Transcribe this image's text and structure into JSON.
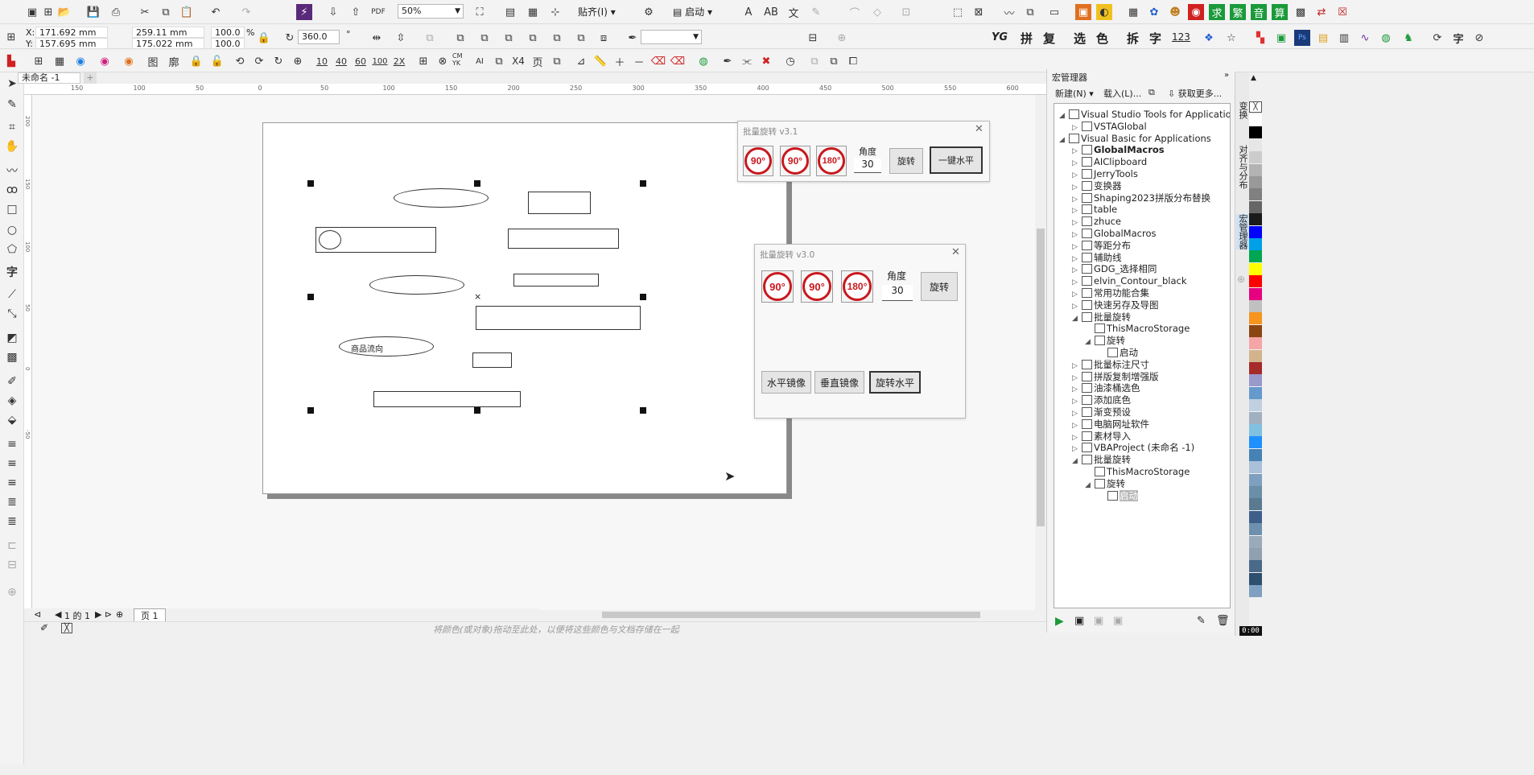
{
  "toolbar1": {
    "zoom": "50%",
    "snap_label": "贴齐(I)",
    "launch_label": "启动"
  },
  "toolbar2": {
    "x": "171.692 mm",
    "y": "157.695 mm",
    "w": "259.11 mm",
    "h": "175.022 mm",
    "sx": "100.0",
    "sy": "100.0",
    "pct": "%",
    "angle": "360.0",
    "x_lbl": "X:",
    "y_lbl": "Y:",
    "tool_text": [
      "拼",
      "复",
      "选",
      "色",
      "拆",
      "字",
      "123"
    ],
    "tool_logo": "YG"
  },
  "toolbar3": {
    "buttons": [
      "10",
      "40",
      "60",
      "100",
      "2X",
      "CM YK",
      "X4",
      "页"
    ]
  },
  "tab": {
    "doc": "未命名 -1"
  },
  "ruler": {
    "h": [
      "150",
      "100",
      "50",
      "0",
      "50",
      "100",
      "150",
      "200",
      "250",
      "300",
      "350",
      "400",
      "450",
      "500",
      "550",
      "600"
    ],
    "v": [
      "200",
      "150",
      "100",
      "50",
      "0",
      "-50"
    ]
  },
  "canvas": {
    "ellipse_text": "商品流向"
  },
  "dialog1": {
    "title": "批量旋转 v3.1",
    "angle_label": "角度",
    "angle_value": "30",
    "rotate": "旋转",
    "level": "一键水平",
    "r90a": "90°",
    "r90b": "90°",
    "r180": "180°"
  },
  "dialog2": {
    "title": "批量旋转 v3.0",
    "angle_label": "角度",
    "angle_value": "30",
    "rotate": "旋转",
    "mirror_h": "水平镜像",
    "mirror_v": "垂直镜像",
    "rotate_level": "旋转水平",
    "r90a": "90°",
    "r90b": "90°",
    "r180": "180°"
  },
  "pagenav": {
    "pages": "1 的 1",
    "page_tab": "页 1"
  },
  "status": {
    "hint": "将颜色(或对象)拖动至此处，以便将这些颜色与文档存储在一起"
  },
  "macro": {
    "title": "宏管理器",
    "new": "新建(N)",
    "load": "载入(L)...",
    "get_more": "获取更多...",
    "items": [
      {
        "label": "Visual Studio Tools for Applications",
        "lvl": 0,
        "exp": "◢"
      },
      {
        "label": "VSTAGlobal",
        "lvl": 1,
        "exp": "▷"
      },
      {
        "label": "Visual Basic for Applications",
        "lvl": 0,
        "exp": "◢"
      },
      {
        "label": "GlobalMacros",
        "lvl": 1,
        "exp": "▷",
        "bold": true
      },
      {
        "label": "AIClipboard",
        "lvl": 1,
        "exp": "▷"
      },
      {
        "label": "JerryTools",
        "lvl": 1,
        "exp": "▷"
      },
      {
        "label": "变换器",
        "lvl": 1,
        "exp": "▷"
      },
      {
        "label": "Shaping2023拼版分布替换",
        "lvl": 1,
        "exp": "▷"
      },
      {
        "label": "table",
        "lvl": 1,
        "exp": "▷"
      },
      {
        "label": "zhuce",
        "lvl": 1,
        "exp": "▷"
      },
      {
        "label": "GlobalMacros",
        "lvl": 1,
        "exp": "▷"
      },
      {
        "label": "等距分布",
        "lvl": 1,
        "exp": "▷"
      },
      {
        "label": "辅助线",
        "lvl": 1,
        "exp": "▷"
      },
      {
        "label": "GDG_选择相同",
        "lvl": 1,
        "exp": "▷"
      },
      {
        "label": "elvin_Contour_black",
        "lvl": 1,
        "exp": "▷"
      },
      {
        "label": "常用功能合集",
        "lvl": 1,
        "exp": "▷"
      },
      {
        "label": "快速另存及导图",
        "lvl": 1,
        "exp": "▷"
      },
      {
        "label": "批量旋转",
        "lvl": 1,
        "exp": "◢"
      },
      {
        "label": "ThisMacroStorage",
        "lvl": 2,
        "exp": ""
      },
      {
        "label": "旋转",
        "lvl": 2,
        "exp": "◢"
      },
      {
        "label": "启动",
        "lvl": 3,
        "exp": ""
      },
      {
        "label": "批量标注尺寸",
        "lvl": 1,
        "exp": "▷"
      },
      {
        "label": "拼版复制增强版",
        "lvl": 1,
        "exp": "▷"
      },
      {
        "label": "油漆桶选色",
        "lvl": 1,
        "exp": "▷"
      },
      {
        "label": "添加底色",
        "lvl": 1,
        "exp": "▷"
      },
      {
        "label": "渐变预设",
        "lvl": 1,
        "exp": "▷"
      },
      {
        "label": "电脑网址软件",
        "lvl": 1,
        "exp": "▷"
      },
      {
        "label": "素材导入",
        "lvl": 1,
        "exp": "▷"
      },
      {
        "label": "VBAProject (未命名 -1)",
        "lvl": 1,
        "exp": "▷"
      },
      {
        "label": "批量旋转",
        "lvl": 1,
        "exp": "◢"
      },
      {
        "label": "ThisMacroStorage",
        "lvl": 2,
        "exp": ""
      },
      {
        "label": "旋转",
        "lvl": 2,
        "exp": "◢"
      },
      {
        "label": "启动",
        "lvl": 3,
        "exp": "",
        "selected": true
      }
    ]
  },
  "side_tabs": [
    "变换",
    "对齐与分布",
    "宏管理器"
  ],
  "palette": [
    "#ffffff",
    "#000000",
    "#e6e6e6",
    "#cccccc",
    "#b3b3b3",
    "#999999",
    "#808080",
    "#666666",
    "#1a1a1a",
    "#0000ff",
    "#00a0e9",
    "#00a651",
    "#ffff00",
    "#ff0000",
    "#e4007f",
    "#c0c0c0",
    "#f7941d",
    "#8b4513",
    "#f5a5a5",
    "#d2b48c",
    "#a52a2a",
    "#9999cc",
    "#6699cc",
    "#c0d0e0",
    "#a0b0c0",
    "#80c0e0",
    "#1e90ff",
    "#4682b4",
    "#a9c0d8",
    "#7f9fbf",
    "#6a8fa8",
    "#5a7a90",
    "#3e5f8a",
    "#6f8faf",
    "#9ab",
    "#8fa0b0",
    "#4a6a88",
    "#2f4f6f",
    "#7fa0c0"
  ],
  "clock": "0:00"
}
